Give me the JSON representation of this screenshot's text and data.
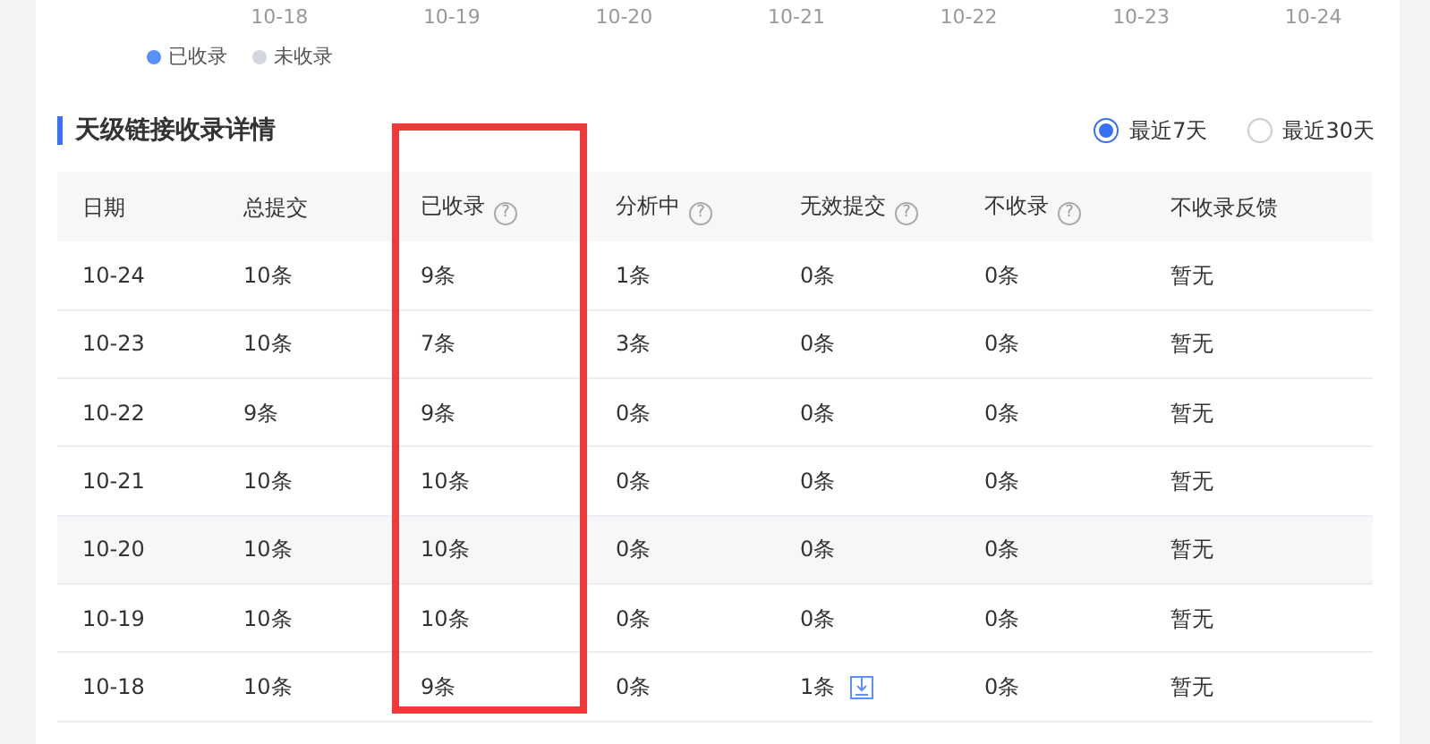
{
  "chart": {
    "x_labels": [
      "10-18",
      "10-19",
      "10-20",
      "10-21",
      "10-22",
      "10-23",
      "10-24"
    ],
    "legend": [
      {
        "label": "已收录",
        "color": "#5b8ff9"
      },
      {
        "label": "未收录",
        "color": "#d3d6dc"
      }
    ]
  },
  "section": {
    "title": "天级链接收录详情",
    "ranges": [
      {
        "label": "最近7天",
        "selected": true
      },
      {
        "label": "最近30天",
        "selected": false
      }
    ]
  },
  "table": {
    "columns": [
      {
        "label": "日期",
        "help": false,
        "highlighted": false
      },
      {
        "label": "总提交",
        "help": false,
        "highlighted": false
      },
      {
        "label": "已收录",
        "help": "?",
        "highlighted": true
      },
      {
        "label": "分析中",
        "help": "?",
        "highlighted": false
      },
      {
        "label": "无效提交",
        "help": "?",
        "highlighted": false
      },
      {
        "label": "不收录",
        "help": "?",
        "highlighted": false
      },
      {
        "label": "不收录反馈",
        "help": false,
        "highlighted": false
      }
    ],
    "rows": [
      {
        "cells": [
          "10-24",
          "10条",
          "9条",
          "1条",
          "0条",
          "0条",
          "暂无"
        ],
        "hovered": false,
        "download": [
          false,
          false,
          false,
          false,
          false,
          false,
          false
        ]
      },
      {
        "cells": [
          "10-23",
          "10条",
          "7条",
          "3条",
          "0条",
          "0条",
          "暂无"
        ],
        "hovered": false,
        "download": [
          false,
          false,
          false,
          false,
          false,
          false,
          false
        ]
      },
      {
        "cells": [
          "10-22",
          "9条",
          "9条",
          "0条",
          "0条",
          "0条",
          "暂无"
        ],
        "hovered": false,
        "download": [
          false,
          false,
          false,
          false,
          false,
          false,
          false
        ]
      },
      {
        "cells": [
          "10-21",
          "10条",
          "10条",
          "0条",
          "0条",
          "0条",
          "暂无"
        ],
        "hovered": false,
        "download": [
          false,
          false,
          false,
          false,
          false,
          false,
          false
        ]
      },
      {
        "cells": [
          "10-20",
          "10条",
          "10条",
          "0条",
          "0条",
          "0条",
          "暂无"
        ],
        "hovered": true,
        "download": [
          false,
          false,
          false,
          false,
          false,
          false,
          false
        ]
      },
      {
        "cells": [
          "10-19",
          "10条",
          "10条",
          "0条",
          "0条",
          "0条",
          "暂无"
        ],
        "hovered": false,
        "download": [
          false,
          false,
          false,
          false,
          false,
          false,
          false
        ]
      },
      {
        "cells": [
          "10-18",
          "10条",
          "9条",
          "0条",
          "1条",
          "0条",
          "暂无"
        ],
        "hovered": false,
        "download": [
          false,
          false,
          false,
          false,
          true,
          false,
          false
        ]
      }
    ]
  }
}
